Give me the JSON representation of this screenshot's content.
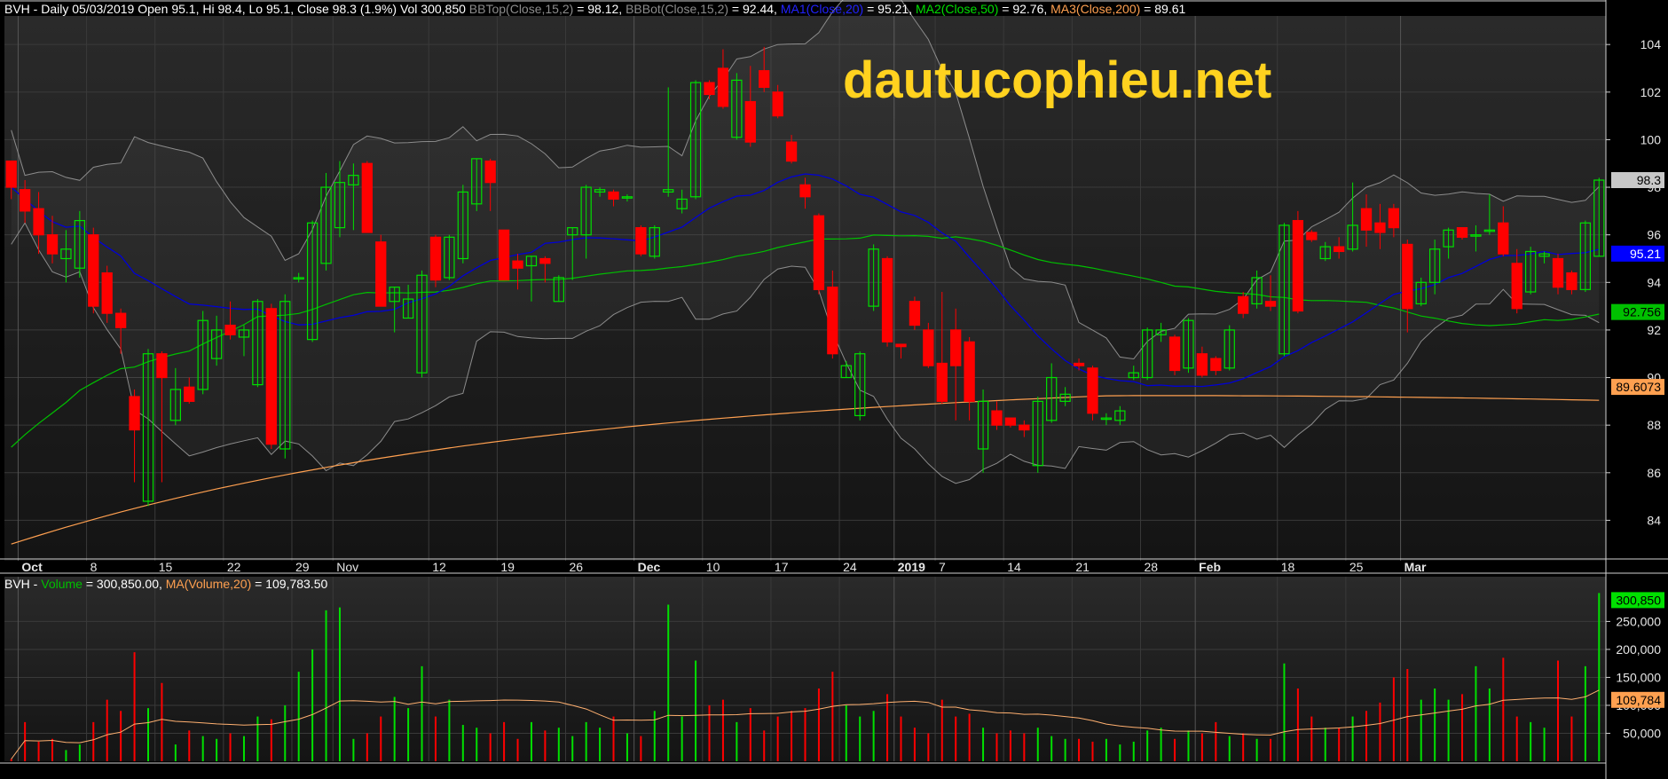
{
  "header": {
    "symbol": "BVH",
    "main_text": " - Daily 05/03/2019 Open 95.1, Hi 98.4, Lo 95.1, Close 98.3 (1.9%) Vol 300,850 ",
    "bbtop_label": "BBTop(Close,15,2)",
    "bbtop_value": " = 98.12, ",
    "bbbot_label": "BBBot(Close,15,2)",
    "bbbot_value": " = 92.44, ",
    "ma1_label": "MA1(Close,20)",
    "ma1_value": " = 95.21, ",
    "ma2_label": "MA2(Close,50)",
    "ma2_value": " = 92.76, ",
    "ma3_label": "MA3(Close,200)",
    "ma3_value": " = 89.61"
  },
  "volume_header": {
    "symbol": "BVH",
    "dash": " - ",
    "vol_label": "Volume",
    "vol_value": " = 300,850.00, ",
    "ma_label": "MA(Volume,20)",
    "ma_value": " = 109,783.50"
  },
  "watermark": "dautucophieu.net",
  "colors": {
    "up": "#00e000",
    "down": "#ff0000",
    "bb": "#8c8c8c",
    "ma1": "#0000d8",
    "ma2": "#00c000",
    "ma3": "#ffa050",
    "vol_ma": "#ffb070",
    "tag_close": "#c8c8c8",
    "tag_ma1": "#0000ff",
    "tag_ma2": "#00c000",
    "tag_ma3": "#ffa050"
  },
  "tags": {
    "close": "98.3",
    "ma1": "95.21",
    "ma2": "92.756",
    "ma3": "89.6073",
    "volume": "300,850",
    "volume_ma": "109,784"
  },
  "chart_data": {
    "type": "candlestick",
    "price_axis": {
      "ylim": [
        82.3,
        105.2
      ],
      "ticks": [
        "84",
        "86",
        "88",
        "90",
        "92",
        "94",
        "96",
        "98",
        "100",
        "102",
        "104"
      ]
    },
    "volume_axis": {
      "ylim": [
        0,
        330000
      ],
      "ticks": [
        "50,000",
        "100,000",
        "150,000",
        "200,000",
        "250,000"
      ]
    },
    "x_labels": [
      {
        "i": 1,
        "label": "Oct",
        "bold": true
      },
      {
        "i": 6,
        "label": "8"
      },
      {
        "i": 11,
        "label": "15"
      },
      {
        "i": 16,
        "label": "22"
      },
      {
        "i": 21,
        "label": "29"
      },
      {
        "i": 24,
        "label": "Nov"
      },
      {
        "i": 31,
        "label": "12"
      },
      {
        "i": 36,
        "label": "19"
      },
      {
        "i": 41,
        "label": "26"
      },
      {
        "i": 46,
        "label": "Dec",
        "bold": true
      },
      {
        "i": 51,
        "label": "10"
      },
      {
        "i": 56,
        "label": "17"
      },
      {
        "i": 61,
        "label": "24"
      },
      {
        "i": 65,
        "label": "2019",
        "bold": true
      },
      {
        "i": 68,
        "label": "7"
      },
      {
        "i": 73,
        "label": "14"
      },
      {
        "i": 78,
        "label": "21"
      },
      {
        "i": 83,
        "label": "28"
      },
      {
        "i": 87,
        "label": "Feb",
        "bold": true
      },
      {
        "i": 93,
        "label": "18"
      },
      {
        "i": 98,
        "label": "25"
      },
      {
        "i": 102,
        "label": "Mar",
        "bold": true
      }
    ],
    "candles": [
      [
        99.1,
        98.0,
        99.1,
        97.5,
        4000
      ],
      [
        97.9,
        97.0,
        98.3,
        96.5,
        70000
      ],
      [
        97.1,
        96.0,
        97.8,
        95.2,
        35000
      ],
      [
        96.0,
        95.2,
        96.8,
        94.8,
        40000
      ],
      [
        95.0,
        95.4,
        96.2,
        94.0,
        20000
      ],
      [
        94.6,
        96.6,
        97.0,
        94.2,
        30000
      ],
      [
        96.0,
        93.0,
        96.3,
        92.7,
        70000
      ],
      [
        94.4,
        92.7,
        94.7,
        92.3,
        110000
      ],
      [
        92.7,
        92.1,
        92.9,
        91.0,
        90000
      ],
      [
        89.2,
        87.8,
        89.5,
        85.6,
        195000
      ],
      [
        84.8,
        91.0,
        91.2,
        84.6,
        95000
      ],
      [
        91.0,
        90.0,
        91.1,
        85.6,
        140000
      ],
      [
        88.2,
        89.5,
        90.4,
        88.0,
        30000
      ],
      [
        89.6,
        89.0,
        90.0,
        88.9,
        55000
      ],
      [
        89.5,
        92.4,
        92.8,
        89.3,
        45000
      ],
      [
        90.8,
        92.0,
        92.6,
        90.5,
        40000
      ],
      [
        92.2,
        91.8,
        93.2,
        91.6,
        50000
      ],
      [
        91.7,
        92.0,
        92.2,
        90.9,
        45000
      ],
      [
        89.7,
        93.2,
        93.3,
        89.6,
        80000
      ],
      [
        92.9,
        87.2,
        93.1,
        87.0,
        75000
      ],
      [
        87.0,
        93.2,
        93.5,
        86.6,
        100000
      ],
      [
        94.2,
        94.2,
        94.4,
        94.0,
        160000
      ],
      [
        91.6,
        96.5,
        96.6,
        91.5,
        200000
      ],
      [
        94.8,
        98.0,
        98.6,
        94.5,
        270000
      ],
      [
        96.3,
        98.2,
        99.1,
        95.9,
        275000
      ],
      [
        98.1,
        98.5,
        99.0,
        96.2,
        40000
      ],
      [
        99.0,
        96.1,
        99.1,
        96.1,
        50000
      ],
      [
        95.7,
        93.0,
        96.0,
        93.0,
        80000
      ],
      [
        93.2,
        93.8,
        93.8,
        91.9,
        115000
      ],
      [
        92.5,
        93.3,
        93.9,
        92.5,
        95000
      ],
      [
        90.2,
        94.3,
        94.5,
        90.0,
        170000
      ],
      [
        95.9,
        94.1,
        96.0,
        93.8,
        80000
      ],
      [
        94.2,
        95.9,
        96.0,
        94.1,
        110000
      ],
      [
        95.0,
        97.8,
        98.1,
        94.8,
        65000
      ],
      [
        97.3,
        99.2,
        99.2,
        97.0,
        60000
      ],
      [
        99.1,
        98.2,
        99.2,
        97.0,
        50000
      ],
      [
        96.2,
        94.1,
        96.2,
        94.1,
        70000
      ],
      [
        94.9,
        94.6,
        95.2,
        93.7,
        40000
      ],
      [
        94.7,
        95.1,
        95.1,
        93.2,
        70000
      ],
      [
        95.0,
        94.8,
        95.1,
        94.0,
        55000
      ],
      [
        93.2,
        94.2,
        94.3,
        93.2,
        60000
      ],
      [
        96.0,
        96.3,
        96.3,
        94.1,
        45000
      ],
      [
        96.0,
        98.0,
        98.1,
        95.0,
        70000
      ],
      [
        97.8,
        97.9,
        98.0,
        97.6,
        60000
      ],
      [
        97.8,
        97.5,
        97.9,
        97.2,
        80000
      ],
      [
        97.6,
        97.6,
        97.7,
        97.4,
        50000
      ],
      [
        96.3,
        95.2,
        96.4,
        95.1,
        45000
      ],
      [
        95.1,
        96.3,
        96.4,
        95.0,
        90000
      ],
      [
        97.8,
        97.9,
        102.2,
        97.6,
        280000
      ],
      [
        97.1,
        97.5,
        97.9,
        96.9,
        80000
      ],
      [
        97.6,
        102.4,
        102.5,
        97.5,
        180000
      ],
      [
        102.4,
        101.9,
        102.5,
        101.7,
        100000
      ],
      [
        103.0,
        101.4,
        103.8,
        101.3,
        110000
      ],
      [
        100.1,
        102.5,
        102.8,
        100.0,
        70000
      ],
      [
        101.6,
        99.9,
        103.1,
        99.7,
        95000
      ],
      [
        102.9,
        102.2,
        103.9,
        102.0,
        55000
      ],
      [
        102.0,
        101.0,
        102.3,
        100.9,
        80000
      ],
      [
        99.9,
        99.1,
        100.2,
        99.0,
        90000
      ],
      [
        98.1,
        97.6,
        98.4,
        97.1,
        95000
      ],
      [
        96.8,
        93.7,
        96.9,
        93.5,
        130000
      ],
      [
        93.8,
        91.0,
        94.5,
        90.8,
        160000
      ],
      [
        90.0,
        90.5,
        90.7,
        90.0,
        100000
      ],
      [
        88.4,
        91.0,
        91.1,
        88.2,
        80000
      ],
      [
        93.0,
        95.4,
        95.6,
        92.8,
        90000
      ],
      [
        95.0,
        91.5,
        95.1,
        91.3,
        120000
      ],
      [
        91.4,
        91.3,
        91.4,
        90.8,
        80000
      ],
      [
        93.2,
        92.2,
        93.4,
        92.0,
        60000
      ],
      [
        92.0,
        90.5,
        92.3,
        90.4,
        50000
      ],
      [
        90.6,
        89.0,
        93.6,
        88.9,
        110000
      ],
      [
        92.0,
        90.5,
        92.9,
        88.2,
        80000
      ],
      [
        91.5,
        89.0,
        91.7,
        88.2,
        85000
      ],
      [
        87.0,
        89.0,
        89.5,
        86.0,
        60000
      ],
      [
        88.6,
        88.0,
        89.0,
        87.8,
        50000
      ],
      [
        88.3,
        88.0,
        88.3,
        87.9,
        55000
      ],
      [
        88.0,
        87.8,
        88.2,
        87.5,
        50000
      ],
      [
        86.3,
        89.0,
        89.2,
        86.0,
        60000
      ],
      [
        88.2,
        90.0,
        90.6,
        88.1,
        45000
      ],
      [
        89.0,
        89.3,
        89.6,
        88.8,
        40000
      ],
      [
        90.6,
        90.5,
        90.8,
        90.3,
        40000
      ],
      [
        90.4,
        88.5,
        90.5,
        88.2,
        35000
      ],
      [
        88.3,
        88.3,
        88.5,
        88.0,
        40000
      ],
      [
        88.2,
        88.6,
        88.8,
        88.0,
        30000
      ],
      [
        90.0,
        90.2,
        90.5,
        89.9,
        35000
      ],
      [
        90.0,
        92.0,
        92.1,
        89.9,
        55000
      ],
      [
        91.8,
        92.0,
        92.3,
        91.5,
        60000
      ],
      [
        91.7,
        90.3,
        91.8,
        90.1,
        40000
      ],
      [
        90.4,
        92.4,
        92.5,
        90.2,
        55000
      ],
      [
        91.0,
        90.1,
        91.3,
        90.0,
        50000
      ],
      [
        90.8,
        90.3,
        90.9,
        90.1,
        70000
      ],
      [
        90.4,
        92.0,
        92.2,
        90.3,
        45000
      ],
      [
        93.4,
        92.7,
        93.6,
        92.5,
        50000
      ],
      [
        93.1,
        94.2,
        94.5,
        92.9,
        40000
      ],
      [
        93.2,
        93.0,
        94.3,
        92.8,
        40000
      ],
      [
        91.0,
        96.4,
        96.5,
        90.9,
        175000
      ],
      [
        96.6,
        92.8,
        97.0,
        92.7,
        130000
      ],
      [
        96.1,
        95.8,
        96.2,
        95.7,
        80000
      ],
      [
        95.0,
        95.5,
        95.7,
        94.9,
        60000
      ],
      [
        95.5,
        95.3,
        95.9,
        95.0,
        60000
      ],
      [
        95.4,
        96.4,
        98.2,
        95.3,
        80000
      ],
      [
        97.1,
        96.2,
        97.7,
        95.5,
        90000
      ],
      [
        96.5,
        96.1,
        97.3,
        95.4,
        105000
      ],
      [
        97.1,
        96.3,
        97.3,
        95.9,
        150000
      ],
      [
        95.6,
        92.9,
        95.8,
        91.9,
        165000
      ],
      [
        93.1,
        94.0,
        94.2,
        93.0,
        110000
      ],
      [
        94.0,
        95.4,
        95.8,
        93.5,
        130000
      ],
      [
        95.5,
        96.2,
        96.3,
        95.0,
        110000
      ],
      [
        96.3,
        95.9,
        96.3,
        95.8,
        120000
      ],
      [
        96.0,
        96.0,
        96.4,
        95.3,
        170000
      ],
      [
        96.2,
        96.2,
        97.7,
        96.0,
        130000
      ],
      [
        96.5,
        95.2,
        97.2,
        95.1,
        185000
      ],
      [
        94.8,
        92.9,
        95.4,
        92.7,
        80000
      ],
      [
        93.6,
        95.3,
        95.5,
        93.5,
        70000
      ],
      [
        95.1,
        95.2,
        95.3,
        94.8,
        60000
      ],
      [
        95.0,
        93.8,
        95.2,
        93.5,
        180000
      ],
      [
        94.4,
        93.7,
        94.5,
        93.5,
        80000
      ],
      [
        93.7,
        96.5,
        96.6,
        93.6,
        170000
      ],
      [
        95.1,
        98.3,
        98.4,
        95.1,
        300850
      ]
    ]
  }
}
